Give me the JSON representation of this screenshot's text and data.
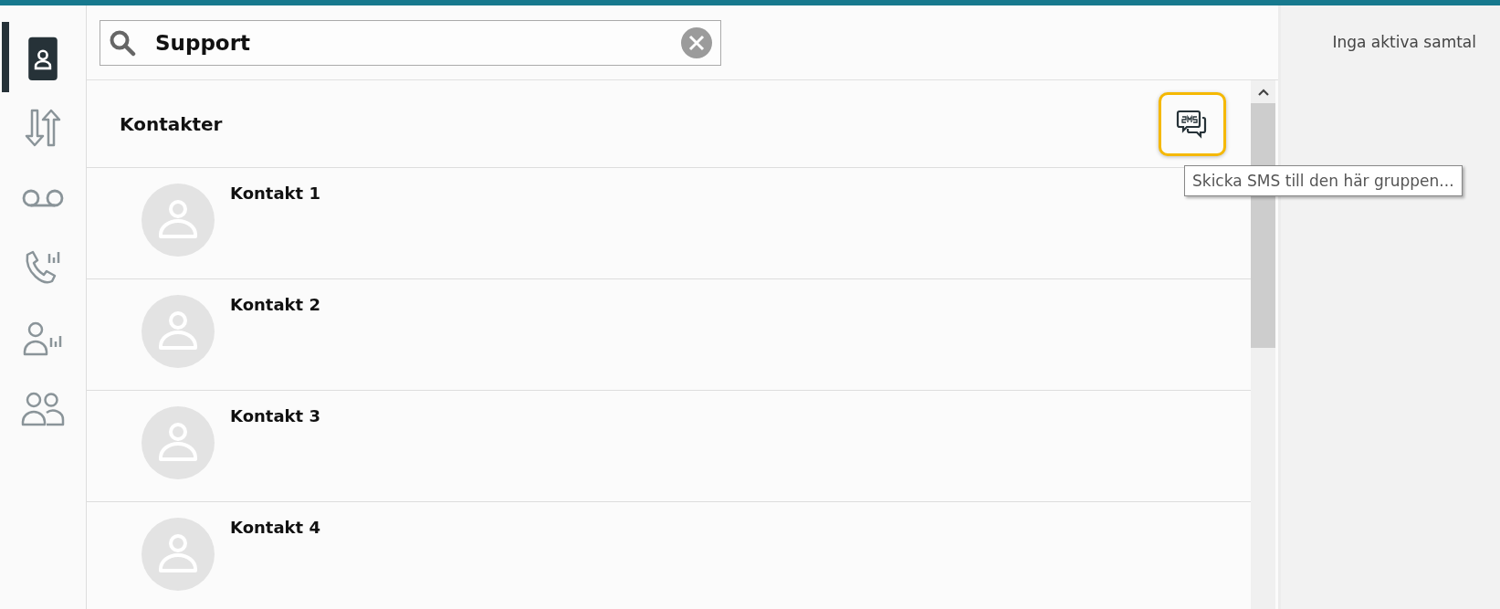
{
  "sidebar": {
    "items": [
      {
        "kind": "contacts",
        "selected": true
      },
      {
        "kind": "transfer",
        "selected": false
      },
      {
        "kind": "voicemail",
        "selected": false
      },
      {
        "kind": "call-stats",
        "selected": false
      },
      {
        "kind": "agent-stats",
        "selected": false
      },
      {
        "kind": "groups",
        "selected": false
      }
    ]
  },
  "search": {
    "value": "Support"
  },
  "section": {
    "title": "Kontakter",
    "sms_button": {
      "focused": true
    }
  },
  "tooltip": {
    "text": "Skicka SMS till den här gruppen..."
  },
  "contacts": [
    {
      "name": "Kontakt 1"
    },
    {
      "name": "Kontakt 2"
    },
    {
      "name": "Kontakt 3"
    },
    {
      "name": "Kontakt 4"
    }
  ],
  "calls_panel": {
    "text": "Inga aktiva samtal"
  }
}
